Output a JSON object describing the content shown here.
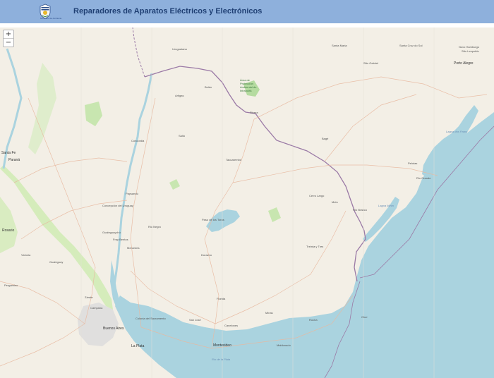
{
  "header": {
    "title": "Reparadores de Aparatos Eléctricos y Electrónicos",
    "logo_text": "Ministerio de Ambiente"
  },
  "map": {
    "zoom_in_label": "+",
    "zoom_out_label": "−",
    "labels": {
      "santa_fe": "Santa Fe",
      "parana": "Paraná",
      "rosario": "Rosario",
      "buenos_aires": "Buenos Aires",
      "la_plata": "La Plata",
      "pergamino": "Pergamino",
      "campana": "Campana",
      "concordia": "Concordia",
      "paysandu": "Paysandú",
      "salto": "Salto",
      "artigas": "Artigas",
      "rivera": "Rivera",
      "tacuarembo": "Tacuarembó",
      "melo": "Melo",
      "bage": "Bagé",
      "pelotas": "Pelotas",
      "rio_grande": "Rio Grande",
      "porto_alegre": "Porto Alegre",
      "santa_maria": "Santa Maria",
      "santa_cruz_do_sul": "Santa Cruz do Sul",
      "novo_hamburgo": "Novo Hamburgo",
      "sao_leopoldo": "São Leopoldo",
      "uruguaiana": "Uruguaiana",
      "montevideo": "Montevideo",
      "canelones": "Canelones",
      "colonia": "Colonia del Sacramento",
      "fray_bentos": "Fray Bentos",
      "mercedes": "Mercedes",
      "durazno": "Durazno",
      "florida": "Florida",
      "minas": "Minas",
      "rocha": "Rocha",
      "maldonado": "Maldonado",
      "treinta_y_tres": "Treinta y Tres",
      "rio_branco": "Río Branco",
      "chui": "Chuí",
      "gualeguaychu": "Gualeguaychú",
      "paso_de_los_toros": "Paso de los Toros",
      "san_jose": "San José",
      "rio_de_la_plata": "Río de la Plata",
      "lagoa_dos_patos": "Lagoa dos Patos",
      "lagoa_mirim": "Lagoa Mirim",
      "area_protegida": "Área de Protección Ambiental do Ibirapuitã",
      "sao_gabriel": "São Gabriel",
      "concepcion_del_uruguay": "Concepción del Uruguay",
      "zarate": "Zárate",
      "gualeguay": "Gualeguay",
      "victoria": "Victoria",
      "belen": "Belén",
      "cerro_largo": "Cerro Largo",
      "rio_negro": "Rio Negro"
    }
  }
}
